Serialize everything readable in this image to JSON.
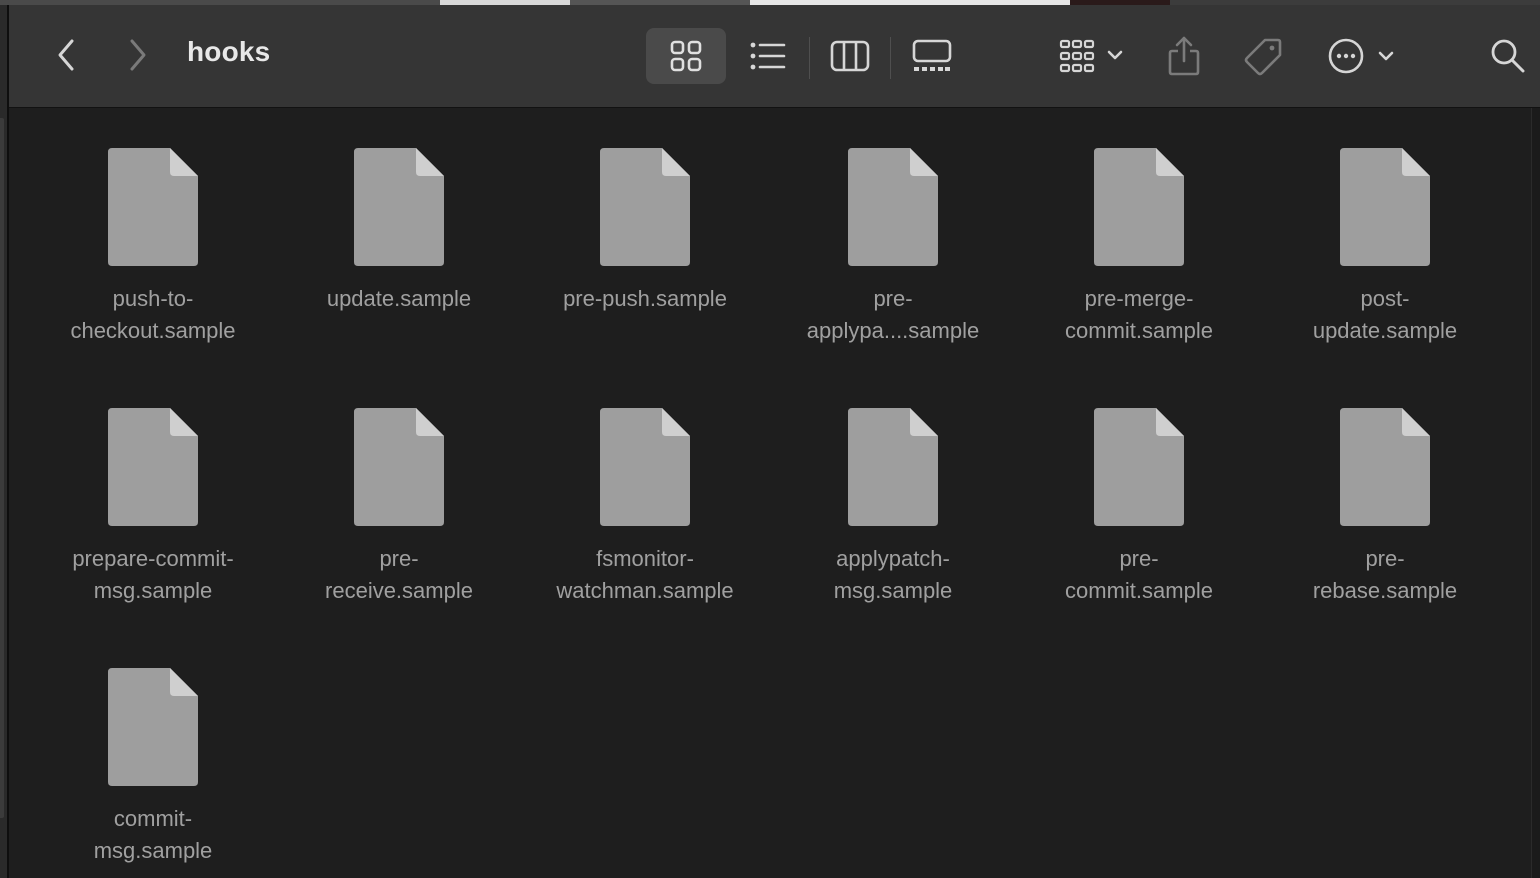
{
  "window": {
    "title": "hooks"
  },
  "toolbar": {
    "back": "back",
    "forward": "forward",
    "view_modes": [
      "icon",
      "list",
      "column",
      "gallery"
    ],
    "selected_view": "icon"
  },
  "files": [
    {
      "name": "push-to-\ncheckout.sample"
    },
    {
      "name": "update.sample"
    },
    {
      "name": "pre-push.sample"
    },
    {
      "name": "pre-\napplypa....sample"
    },
    {
      "name": "pre-merge-\ncommit.sample"
    },
    {
      "name": "post-\nupdate.sample"
    },
    {
      "name": "prepare-commit-\nmsg.sample"
    },
    {
      "name": "pre-\nreceive.sample"
    },
    {
      "name": "fsmonitor-\nwatchman.sample"
    },
    {
      "name": "applypatch-\nmsg.sample"
    },
    {
      "name": "pre-\ncommit.sample"
    },
    {
      "name": "pre-\nrebase.sample"
    },
    {
      "name": "commit-\nmsg.sample"
    }
  ],
  "colors": {
    "background": "#1e1e1e",
    "toolbar": "#353535",
    "icon_gray": "#9e9e9e",
    "label_gray": "#a0a0a0"
  }
}
